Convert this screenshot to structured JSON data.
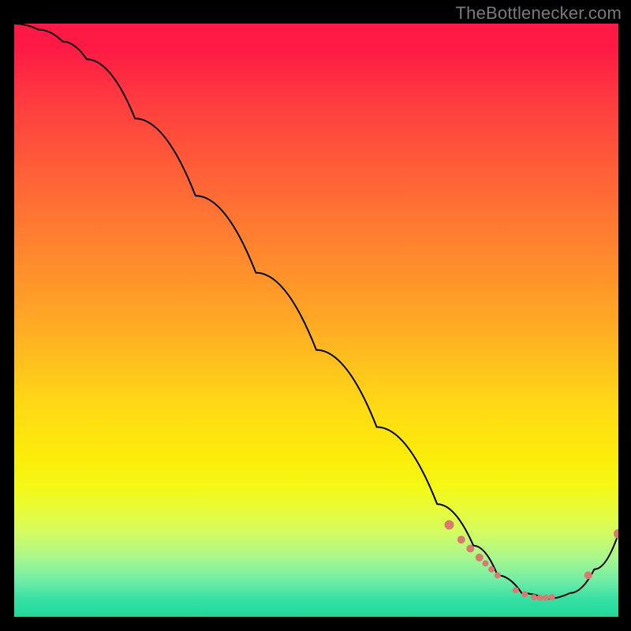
{
  "attribution": "TheBottlenecker.com",
  "chart_data": {
    "type": "line",
    "title": "",
    "xlabel": "",
    "ylabel": "",
    "xlim": [
      0,
      100
    ],
    "ylim": [
      0,
      100
    ],
    "series": [
      {
        "name": "curve",
        "color": "#000000",
        "x": [
          0,
          4,
          8,
          12,
          20,
          30,
          40,
          50,
          60,
          70,
          76,
          80,
          84,
          88,
          92,
          96,
          100
        ],
        "values": [
          100,
          99,
          97,
          94,
          84,
          71,
          58,
          45,
          32,
          19,
          12,
          7,
          4,
          3,
          4,
          8,
          14
        ]
      }
    ],
    "markers": {
      "name": "dots",
      "color": "#d87a6f",
      "x": [
        72,
        74,
        75.5,
        77,
        78,
        79,
        80,
        83,
        84.5,
        86,
        87,
        88,
        89,
        95,
        100
      ],
      "values": [
        15.5,
        13,
        11.5,
        10,
        9,
        8,
        7,
        4.5,
        3.8,
        3.3,
        3.2,
        3.2,
        3.3,
        7,
        14
      ]
    },
    "marker_sizes": [
      6,
      5,
      5,
      5,
      4,
      4,
      4,
      4,
      4,
      4,
      4,
      4,
      4,
      5,
      6
    ]
  }
}
